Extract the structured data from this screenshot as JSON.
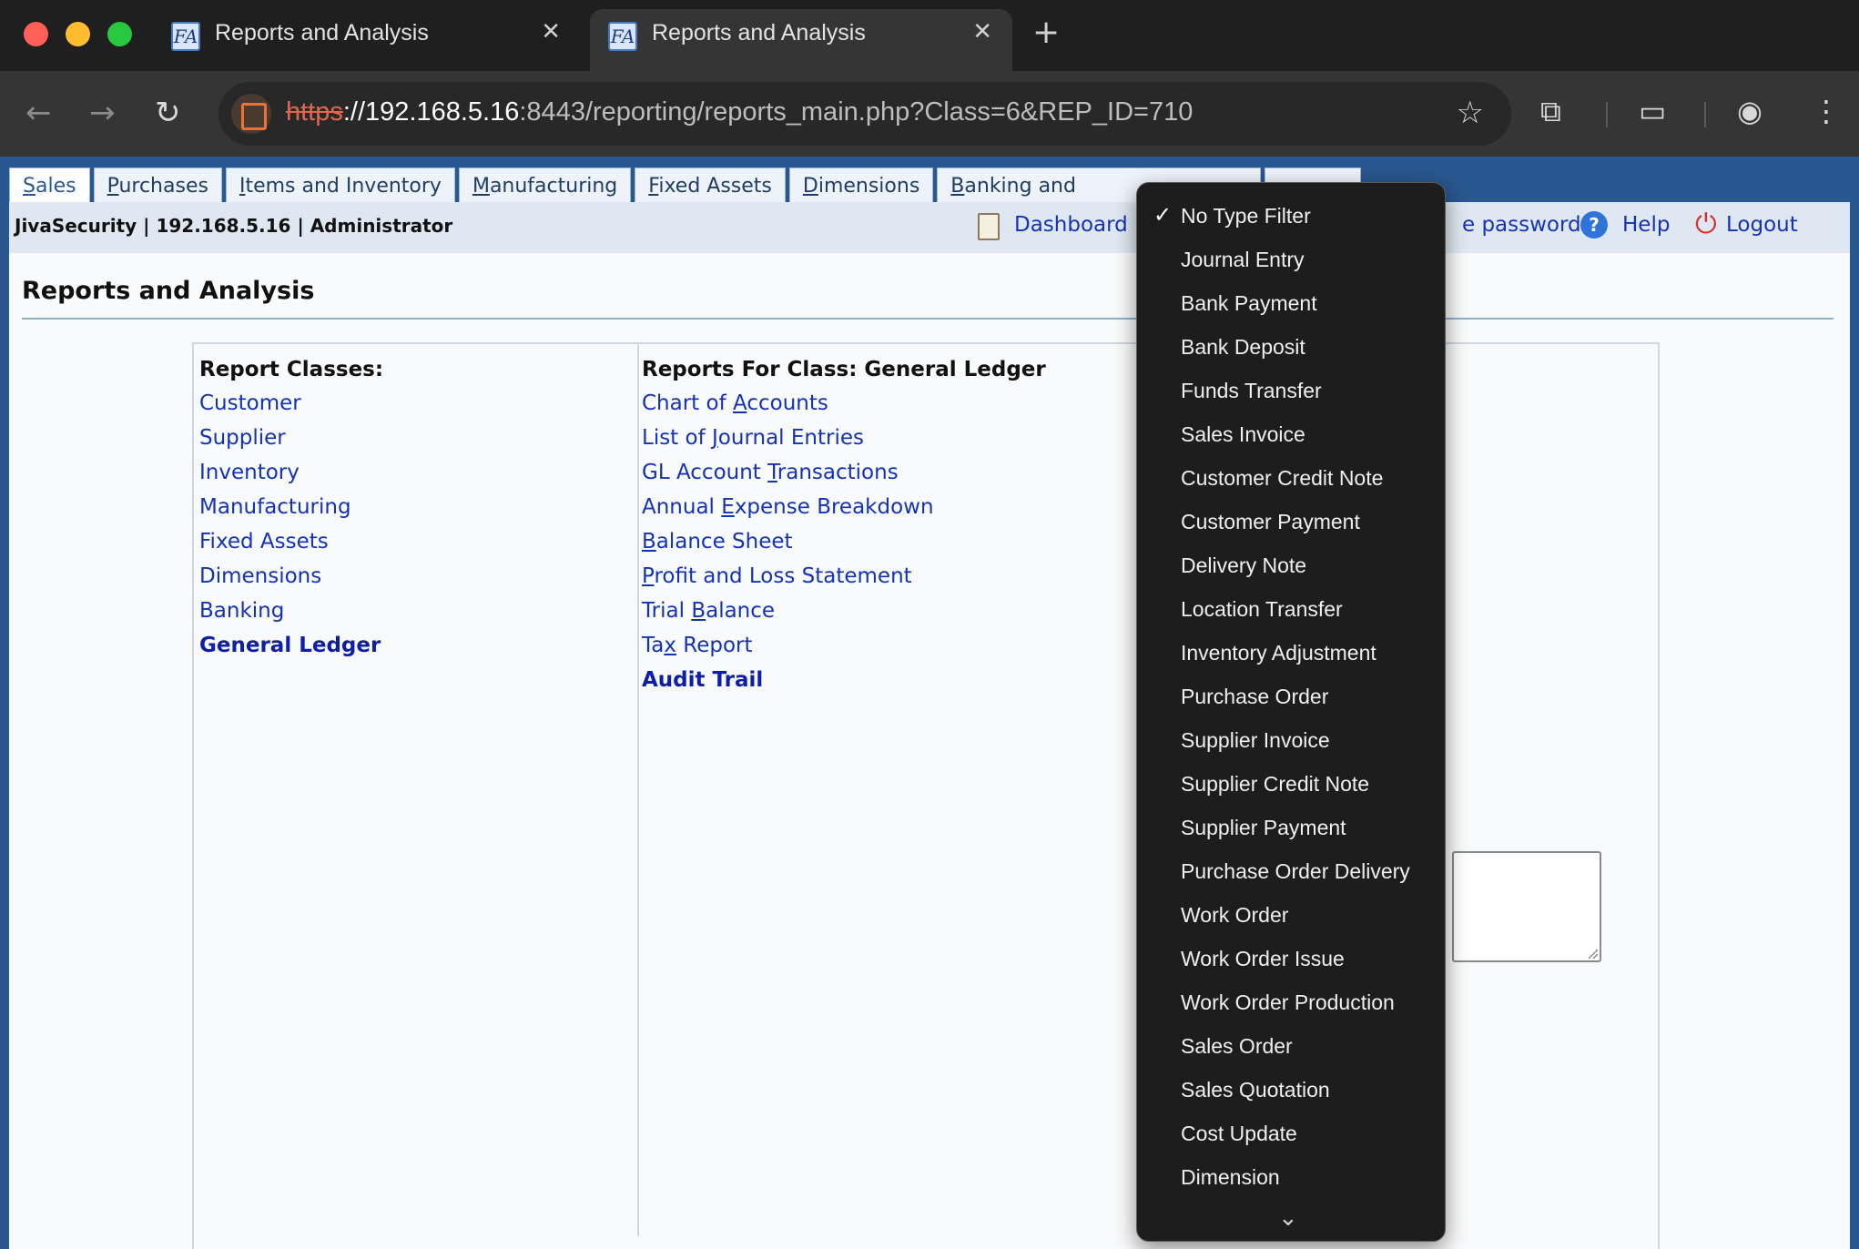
{
  "browser": {
    "tabs": [
      {
        "title": "Reports and Analysis",
        "favicon": "FA"
      },
      {
        "title": "Reports and Analysis",
        "favicon": "FA"
      }
    ],
    "url": {
      "scheme": "https",
      "host": "://192.168.5.16",
      "rest": ":8443/reporting/reports_main.php?Class=6&REP_ID=710"
    }
  },
  "menu": {
    "tabs": [
      {
        "first": "S",
        "rest": "ales"
      },
      {
        "first": "P",
        "rest": "urchases"
      },
      {
        "first": "I",
        "rest": "tems and Inventory"
      },
      {
        "first": "M",
        "rest": "anufacturing"
      },
      {
        "first": "F",
        "rest": "ixed Assets"
      },
      {
        "first": "D",
        "rest": "imensions"
      },
      {
        "first": "B",
        "rest": "anking and"
      }
    ]
  },
  "userbar": {
    "info": "JivaSecurity | 192.168.5.16 | Administrator",
    "dashboard": "Dashboard",
    "password": "e password",
    "help": "Help",
    "logout": "Logout"
  },
  "page": {
    "title": "Reports and Analysis"
  },
  "classes": {
    "header": "Report Classes:",
    "items": [
      "Customer",
      "Supplier",
      "Inventory",
      "Manufacturing",
      "Fixed Assets",
      "Dimensions",
      "Banking",
      "General Ledger"
    ]
  },
  "reports": {
    "header": "Reports For Class:  General Ledger",
    "items": [
      {
        "pre": "Chart of ",
        "ul": "A",
        "post": "ccounts"
      },
      {
        "pre": "List of ",
        "ul": "J",
        "post": "ournal Entries"
      },
      {
        "pre": "GL Account ",
        "ul": "T",
        "post": "ransactions"
      },
      {
        "pre": "Annual ",
        "ul": "E",
        "post": "xpense Breakdown"
      },
      {
        "pre": "",
        "ul": "B",
        "post": "alance Sheet"
      },
      {
        "pre": "",
        "ul": "P",
        "post": "rofit and Loss Statement"
      },
      {
        "pre": "Trial ",
        "ul": "B",
        "post": "alance"
      },
      {
        "pre": "Ta",
        "ul": "x",
        "post": " Report"
      },
      {
        "pre": "Audit Trail",
        "ul": "",
        "post": ""
      }
    ]
  },
  "dropdown": {
    "check": "✓",
    "options": [
      "No Type Filter",
      "Journal Entry",
      "Bank Payment",
      "Bank Deposit",
      "Funds Transfer",
      "Sales Invoice",
      "Customer Credit Note",
      "Customer Payment",
      "Delivery Note",
      "Location Transfer",
      "Inventory Adjustment",
      "Purchase Order",
      "Supplier Invoice",
      "Supplier Credit Note",
      "Supplier Payment",
      "Purchase Order Delivery",
      "Work Order",
      "Work Order Issue",
      "Work Order Production",
      "Sales Order",
      "Sales Quotation",
      "Cost Update",
      "Dimension"
    ]
  }
}
